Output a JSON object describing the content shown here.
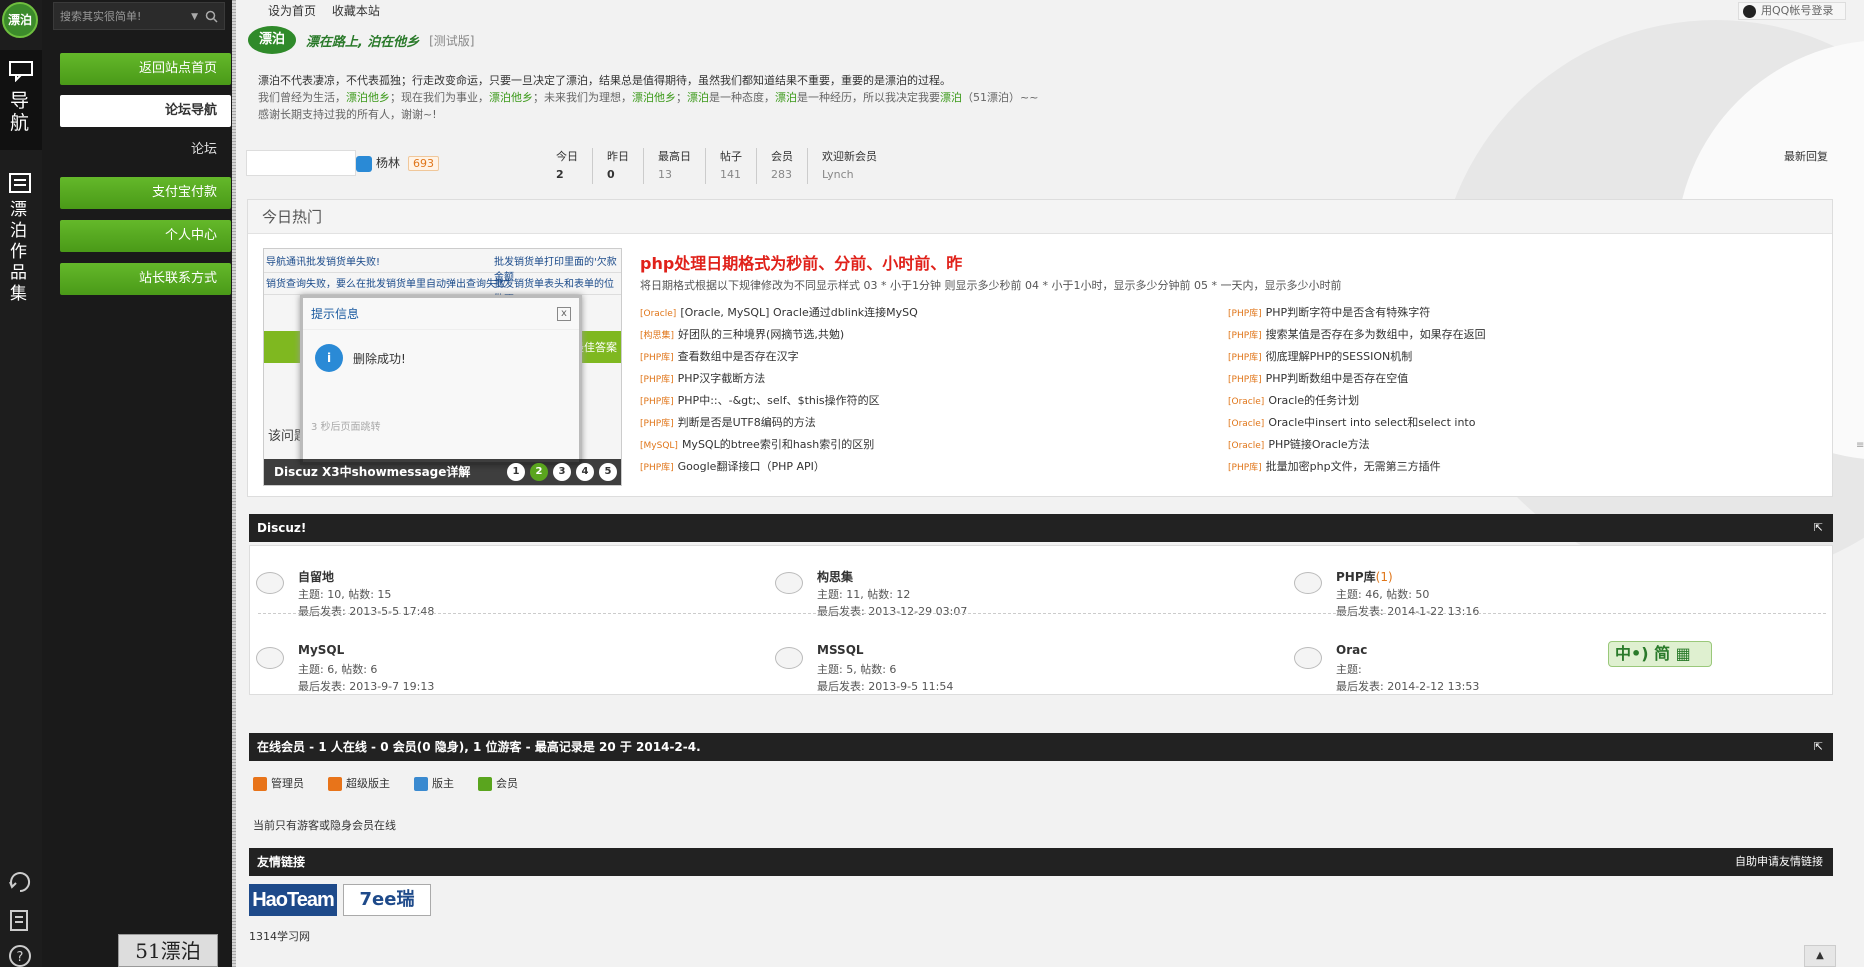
{
  "strip": {
    "logo": "漂泊",
    "nav_label": "导航",
    "works_label": "漂泊作品集"
  },
  "sidebar": {
    "search_placeholder": "搜索其实很简单!",
    "items": [
      {
        "label": "返回站点首页"
      },
      {
        "label": "论坛导航"
      },
      {
        "label": "论坛"
      },
      {
        "label": "支付宝付款"
      },
      {
        "label": "个人中心"
      },
      {
        "label": "站长联系方式"
      }
    ],
    "thumb": "51漂泊"
  },
  "top": {
    "set_home": "设为首页",
    "favorite": "收藏本站",
    "qq_login": "用QQ帐号登录"
  },
  "brand": {
    "mark": "漂泊",
    "slogan": "漂在路上, 泊在他乡",
    "test": "[测试版]"
  },
  "intro": {
    "line1": "漂泊不代表凄凉，不代表孤独；行走改变命运，只要一旦决定了漂泊，结果总是值得期待，虽然我们都知道结果不重要，重要的是漂泊的过程。",
    "line2_a": "我们曾经为生活，",
    "line2_b": "漂泊他乡",
    "line2_c": "；现在我们为事业，",
    "line2_d": "漂泊他乡",
    "line2_e": "；未来我们为理想，",
    "line2_f": "漂泊他乡",
    "line2_g": "；",
    "line2_h": "漂泊",
    "line2_i": "是一种态度，",
    "line2_j": "漂泊",
    "line2_k": "是一种经历，所以我决定我要",
    "line2_l": "漂泊",
    "line2_m": "（51漂泊）~~",
    "line3": "感谢长期支持过我的所有人，谢谢~!"
  },
  "user": {
    "name": "杨林",
    "points": "693"
  },
  "stats": [
    {
      "label": "今日",
      "value": "2"
    },
    {
      "label": "昨日",
      "value": "0"
    },
    {
      "label": "最高日",
      "value": "13"
    },
    {
      "label": "帖子",
      "value": "141"
    },
    {
      "label": "会员",
      "value": "283"
    },
    {
      "label": "欢迎新会员",
      "value": "Lynch"
    }
  ],
  "latest_reply": "最新回复",
  "hot": {
    "heading": "今日热门",
    "slide": {
      "row1": "导航通讯批发销货单失败!",
      "row1b": "批发销货单打印里面的'欠款金额",
      "row2": "销货查询失败，要么在批发销货单里自动弹出查询失败",
      "row2b": "批发销货单表头和表单的位数不",
      "band_text": "最佳答案",
      "dialog_title": "提示信息",
      "dialog_close": "x",
      "dialog_icon": "i",
      "dialog_msg": "删除成功!",
      "dialog_footer": "3 秒后页面跳转",
      "ask": "该问题",
      "caption": "Discuz X3中showmessage详解",
      "dots": [
        "1",
        "2",
        "3",
        "4",
        "5"
      ]
    },
    "title": "php处理日期格式为秒前、分前、小时前、昨",
    "desc": "将日期格式根据以下规律修改为不同显示样式 03 * 小于1分钟 则显示多少秒前 04 * 小于1小时，显示多少分钟前 05 * 一天内，显示多少小时前",
    "left": [
      {
        "tag": "[Oracle]",
        "text": "[Oracle, MySQL] Oracle通过dblink连接MySQ"
      },
      {
        "tag": "[构思集]",
        "text": "好团队的三种境界(网摘节选,共勉)"
      },
      {
        "tag": "[PHP库]",
        "text": "查看数组中是否存在汉字"
      },
      {
        "tag": "[PHP库]",
        "text": "PHP汉字截断方法"
      },
      {
        "tag": "[PHP库]",
        "text": "PHP中::、-&gt;、self、$this操作符的区"
      },
      {
        "tag": "[PHP库]",
        "text": "判断是否是UTF8编码的方法"
      },
      {
        "tag": "[MySQL]",
        "text": "MySQL的btree索引和hash索引的区别"
      },
      {
        "tag": "[PHP库]",
        "text": "Google翻译接口（PHP API）"
      }
    ],
    "right": [
      {
        "tag": "[PHP库]",
        "text": "PHP判断字符中是否含有特殊字符"
      },
      {
        "tag": "[PHP库]",
        "text": "搜索某值是否存在多为数组中，如果存在返回"
      },
      {
        "tag": "[PHP库]",
        "text": "彻底理解PHP的SESSION机制"
      },
      {
        "tag": "[PHP库]",
        "text": "PHP判断数组中是否存在空值"
      },
      {
        "tag": "[Oracle]",
        "text": "Oracle的任务计划"
      },
      {
        "tag": "[Oracle]",
        "text": "Oracle中insert into select和select into"
      },
      {
        "tag": "[Oracle]",
        "text": "PHP链接Oracle方法"
      },
      {
        "tag": "[PHP库]",
        "text": "批量加密php文件，无需第三方插件"
      }
    ]
  },
  "discuz": {
    "title": "Discuz!",
    "forums": [
      {
        "name": "自留地",
        "new": "",
        "stats": "主题: 10, 帖数: 15",
        "last": "最后发表: 2013-5-5 17:48"
      },
      {
        "name": "构思集",
        "new": "",
        "stats": "主题: 11, 帖数: 12",
        "last": "最后发表: 2013-12-29 03:07"
      },
      {
        "name": "PHP库",
        "new": "(1)",
        "stats": "主题: 46, 帖数: 50",
        "last": "最后发表: 2014-1-22 13:16"
      },
      {
        "name": "MySQL",
        "new": "",
        "stats": "主题: 6, 帖数: 6",
        "last": "最后发表: 2013-9-7 19:13"
      },
      {
        "name": "MSSQL",
        "new": "",
        "stats": "主题: 5, 帖数: 6",
        "last": "最后发表: 2013-9-5 11:54"
      },
      {
        "name": "Orac",
        "new": "",
        "stats": "主题: ",
        "last": "最后发表: 2014-2-12 13:53"
      }
    ]
  },
  "ime": "中•) 简 ▦",
  "online": {
    "title": "在线会员 - 1 人在线 - 0 会员(0 隐身), 1 位游客 - 最高记录是 20 于 2014-2-4.",
    "legend": [
      {
        "label": "管理员",
        "color": "#e8741a"
      },
      {
        "label": "超级版主",
        "color": "#e8741a"
      },
      {
        "label": "版主",
        "color": "#3a8ad0"
      },
      {
        "label": "会员",
        "color": "#5aa51e"
      }
    ],
    "note": "当前只有游客或隐身会员在线"
  },
  "links": {
    "title": "友情链接",
    "apply": "自助申请友情链接",
    "logo1": "HaoTeam",
    "logo2": "7ee瑞",
    "text": "1314学习网"
  },
  "totop": "▲"
}
